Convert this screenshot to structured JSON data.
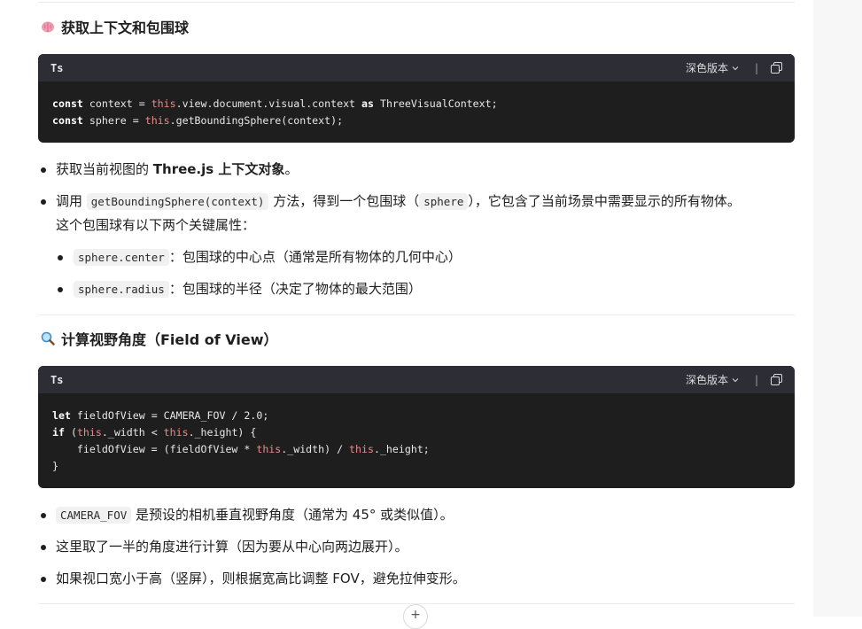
{
  "section1": {
    "icon": "brain-icon",
    "heading": "获取上下文和包围球",
    "code": {
      "lang": "Ts",
      "theme_label": "深色版本",
      "lines": [
        "const context = this.view.document.visual.context as ThreeVisualContext;",
        "const sphere = this.getBoundingSphere(context);"
      ]
    },
    "bullets": {
      "b1_pre": "获取当前视图的 ",
      "b1_bold": "Three.js 上下文对象",
      "b1_post": "。",
      "b2_pre": "调用 ",
      "b2_code": "getBoundingSphere(context)",
      "b2_mid": " 方法，得到一个包围球（",
      "b2_code2": "sphere",
      "b2_post": "），它包含了当前场景中需要显示的所有物体。",
      "b2_line2": "这个包围球有以下两个关键属性：",
      "sub1_code": "sphere.center",
      "sub1_text": "：包围球的中心点（通常是所有物体的几何中心）",
      "sub2_code": "sphere.radius",
      "sub2_text": "：包围球的半径（决定了物体的最大范围）"
    }
  },
  "section2": {
    "icon": "magnifier-icon",
    "heading": "计算视野角度（Field of View）",
    "code": {
      "lang": "Ts",
      "theme_label": "深色版本",
      "lines": [
        "let fieldOfView = CAMERA_FOV / 2.0;",
        "if (this._width < this._height) {",
        "    fieldOfView = (fieldOfView * this._width) / this._height;",
        "}"
      ]
    },
    "bullets": {
      "b1_code": "CAMERA_FOV",
      "b1_text": " 是预设的相机垂直视野角度（通常为 45° 或类似值）。",
      "b2_text": "这里取了一半的角度进行计算（因为要从中心向两边展开）。",
      "b3_text": "如果视口宽小于高（竖屏），则根据宽高比调整 FOV，避免拉伸变形。"
    }
  },
  "footer": {
    "plus_label": "+"
  }
}
